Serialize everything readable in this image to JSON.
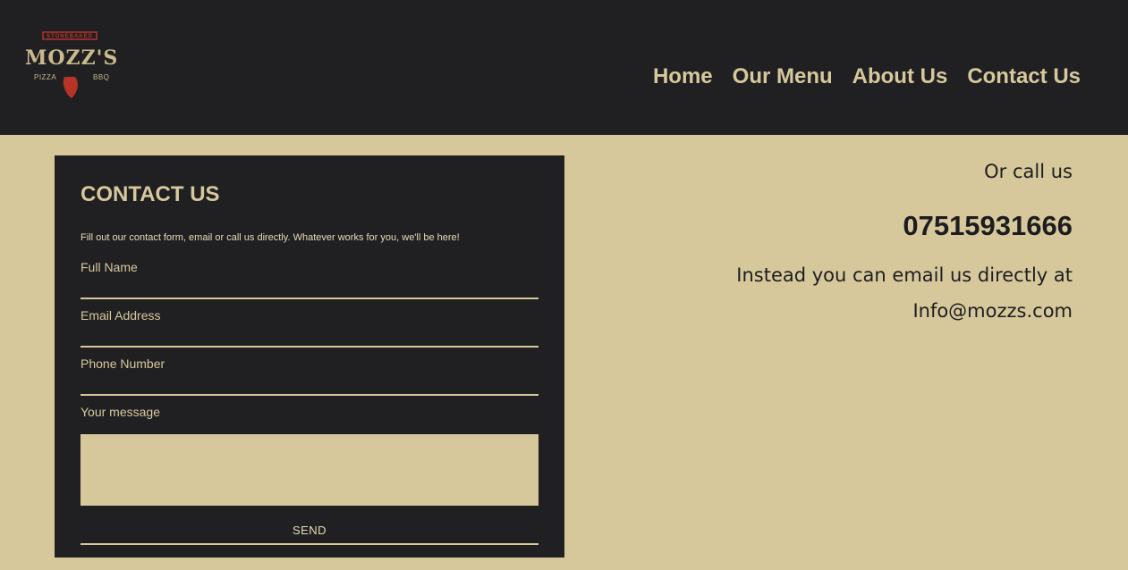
{
  "logo": {
    "top_text": "STONEBAKED",
    "name": "MOZZ'S",
    "left_text": "PIZZA",
    "right_text": "BBQ"
  },
  "nav": {
    "items": [
      {
        "label": "Home"
      },
      {
        "label": "Our Menu"
      },
      {
        "label": "About Us"
      },
      {
        "label": "Contact Us"
      }
    ]
  },
  "form": {
    "title": "CONTACT US",
    "intro": "Fill out our contact form, email or call us directly. Whatever works for you, we'll be here!",
    "fields": {
      "full_name": {
        "label": "Full Name",
        "value": ""
      },
      "email": {
        "label": "Email Address",
        "value": ""
      },
      "phone": {
        "label": "Phone Number",
        "value": ""
      },
      "message": {
        "label": "Your message",
        "value": ""
      }
    },
    "send_label": "SEND"
  },
  "contact": {
    "call_label": "Or call us",
    "phone": "07515931666",
    "email_text": "Instead you can email us directly at",
    "email": "Info@mozzs.com"
  },
  "colors": {
    "dark": "#202023",
    "beige": "#d7c89c",
    "logo_red": "#b53327"
  }
}
